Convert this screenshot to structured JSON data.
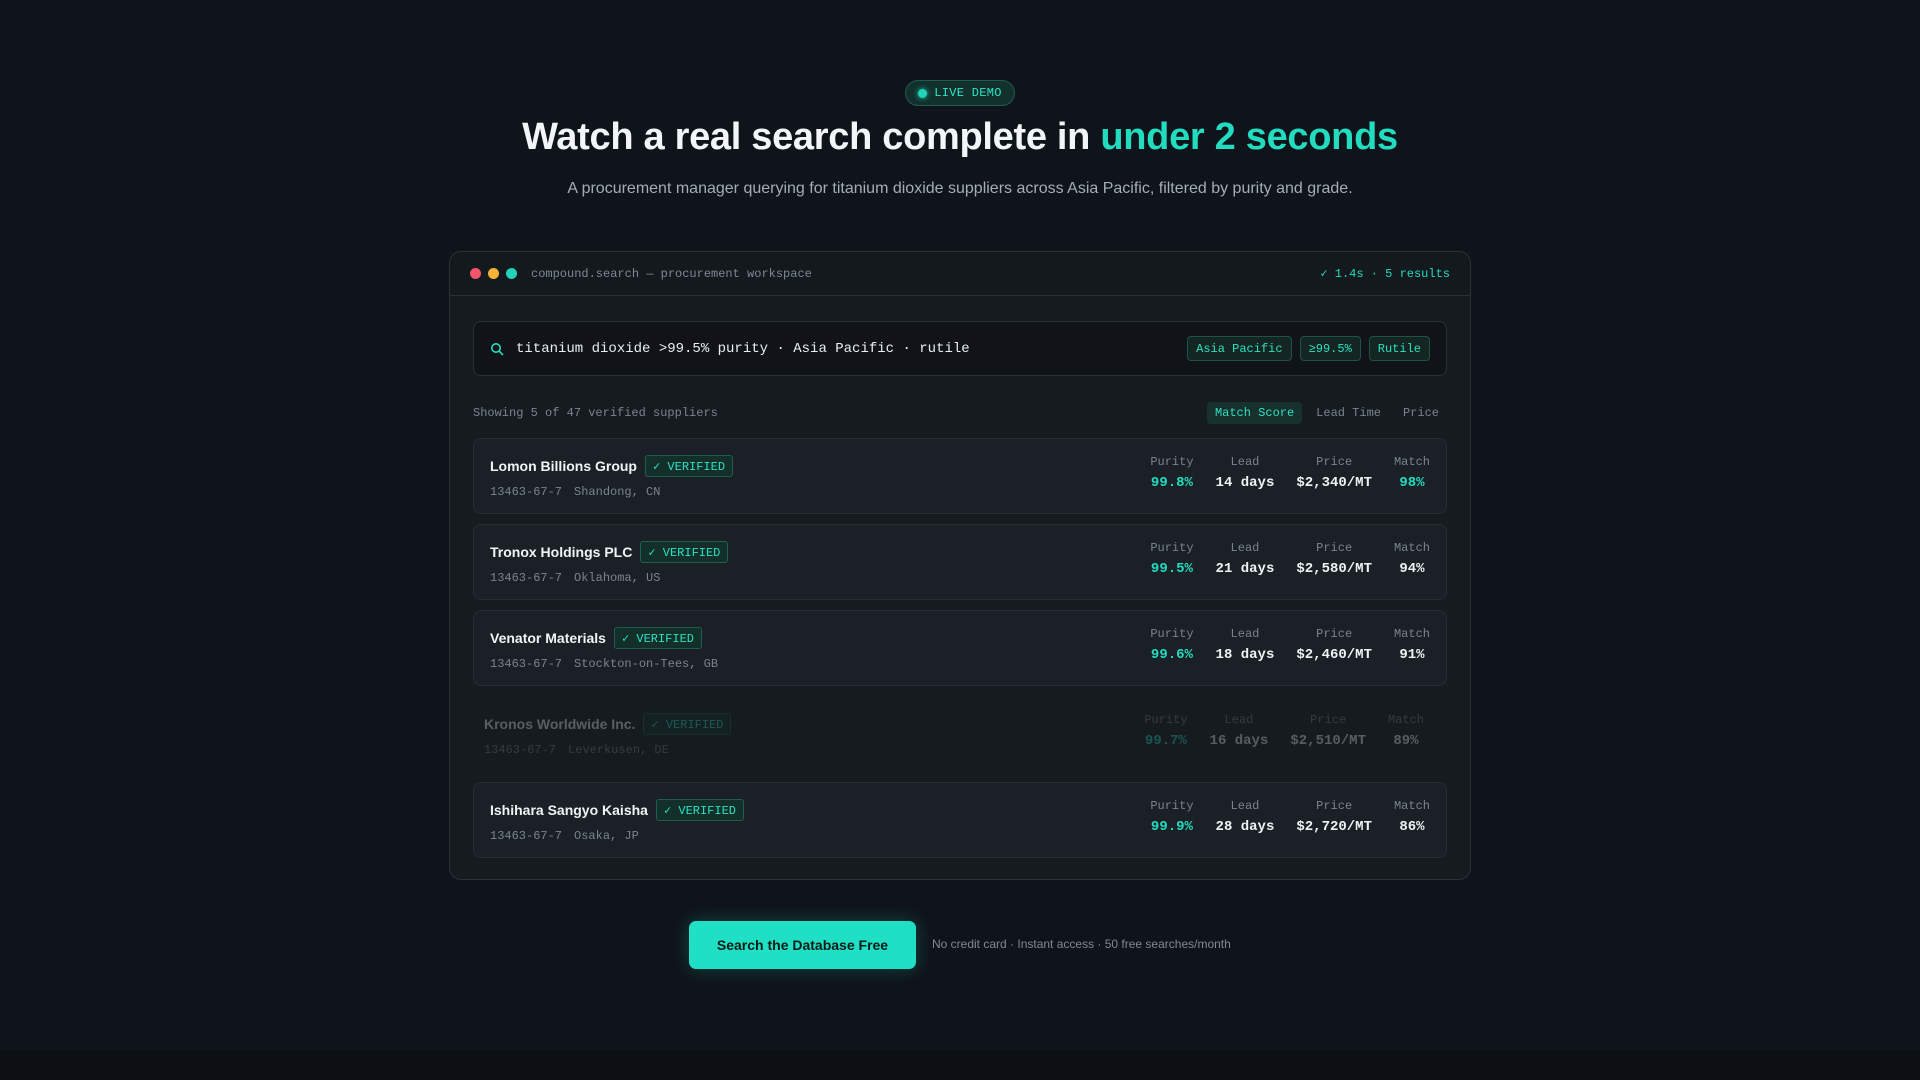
{
  "badge": {
    "label": "LIVE DEMO"
  },
  "headline": {
    "prefix": "Watch a real search complete in ",
    "accent": "under 2 seconds"
  },
  "subheadline": "A procurement manager querying for titanium dioxide suppliers across Asia Pacific, filtered by purity and grade.",
  "window": {
    "title": "compound.search — procurement workspace",
    "status": "✓ 1.4s · 5 results"
  },
  "search": {
    "query": "titanium dioxide >99.5% purity · Asia Pacific · rutile",
    "chips": [
      "Asia Pacific",
      "≥99.5%",
      "Rutile"
    ]
  },
  "results_meta": {
    "showing": "Showing 5 of 47 verified suppliers",
    "sort_options": [
      "Match Score",
      "Lead Time",
      "Price"
    ],
    "active_sort": "Match Score"
  },
  "labels": {
    "verified": "✓ VERIFIED",
    "purity": "Purity",
    "lead": "Lead",
    "price": "Price",
    "match": "Match"
  },
  "suppliers": [
    {
      "name": "Lomon Billions Group",
      "cas": "13463-67-7",
      "location": "Shandong, CN",
      "purity": "99.8%",
      "lead": "14 days",
      "price": "$2,340/MT",
      "match": "98%",
      "match_highlight": true,
      "faded": false
    },
    {
      "name": "Tronox Holdings PLC",
      "cas": "13463-67-7",
      "location": "Oklahoma, US",
      "purity": "99.5%",
      "lead": "21 days",
      "price": "$2,580/MT",
      "match": "94%",
      "match_highlight": false,
      "faded": false
    },
    {
      "name": "Venator Materials",
      "cas": "13463-67-7",
      "location": "Stockton-on-Tees, GB",
      "purity": "99.6%",
      "lead": "18 days",
      "price": "$2,460/MT",
      "match": "91%",
      "match_highlight": false,
      "faded": false
    },
    {
      "name": "Kronos Worldwide Inc.",
      "cas": "13463-67-7",
      "location": "Leverkusen, DE",
      "purity": "99.7%",
      "lead": "16 days",
      "price": "$2,510/MT",
      "match": "89%",
      "match_highlight": false,
      "faded": true
    },
    {
      "name": "Ishihara Sangyo Kaisha",
      "cas": "13463-67-7",
      "location": "Osaka, JP",
      "purity": "99.9%",
      "lead": "28 days",
      "price": "$2,720/MT",
      "match": "86%",
      "match_highlight": false,
      "faded": false
    }
  ],
  "cta": {
    "label": "Search the Database Free",
    "note": "No credit card · Instant access · 50 free searches/month"
  },
  "colors": {
    "accent": "#22dcc0",
    "background": "#0f141a",
    "panel": "#161b20"
  }
}
